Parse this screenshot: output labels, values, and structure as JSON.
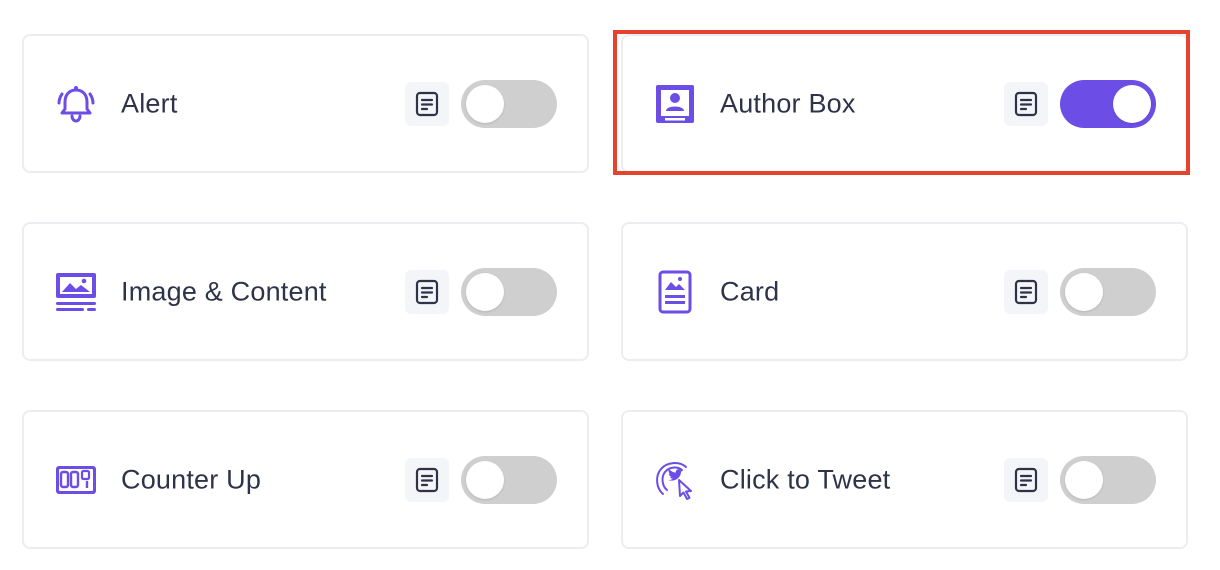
{
  "colors": {
    "accent": "#6c4ee6",
    "toggle_off": "#cfcfcf",
    "highlight_border": "#e5432e",
    "card_border": "#ebedf0",
    "label_text": "#2f3349"
  },
  "widgets": [
    {
      "label": "Alert",
      "icon": "bell-icon",
      "doc_icon": "document-icon",
      "enabled": false,
      "highlighted": false
    },
    {
      "label": "Author Box",
      "icon": "author-box-icon",
      "doc_icon": "document-icon",
      "enabled": true,
      "highlighted": true
    },
    {
      "label": "Image & Content",
      "icon": "image-content-icon",
      "doc_icon": "document-icon",
      "enabled": false,
      "highlighted": false
    },
    {
      "label": "Card",
      "icon": "card-icon",
      "doc_icon": "document-icon",
      "enabled": false,
      "highlighted": false
    },
    {
      "label": "Counter Up",
      "icon": "counter-icon",
      "doc_icon": "document-icon",
      "enabled": false,
      "highlighted": false
    },
    {
      "label": "Click to Tweet",
      "icon": "click-to-tweet-icon",
      "doc_icon": "document-icon",
      "enabled": false,
      "highlighted": false
    }
  ]
}
